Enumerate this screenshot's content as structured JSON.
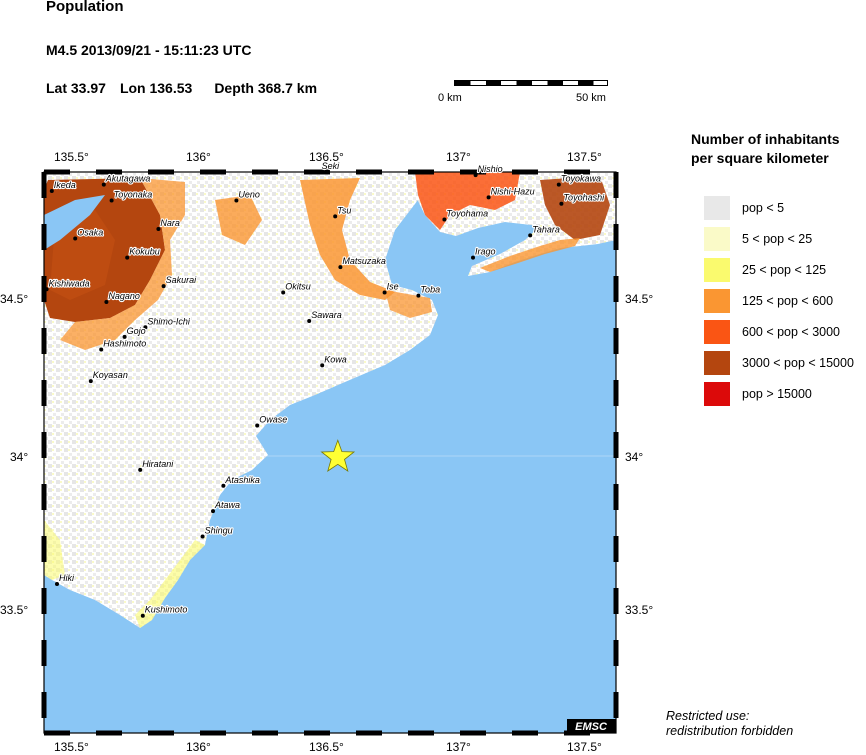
{
  "header": {
    "title": "Population",
    "event": "M4.5  2013/09/21 - 15:11:23 UTC",
    "lat": "Lat 33.97",
    "lon": "Lon 136.53",
    "depth": "Depth 368.7 km"
  },
  "scale_bar": {
    "start_label": "0 km",
    "end_label": "50 km"
  },
  "axes": {
    "lon_ticks": [
      "135.5°",
      "136°",
      "136.5°",
      "137°",
      "137.5°"
    ],
    "lat_ticks": [
      "34.5°",
      "34°",
      "33.5°"
    ]
  },
  "map": {
    "lon_range": [
      135.4,
      137.6
    ],
    "lat_range": [
      33.1,
      34.87
    ],
    "epicenter": {
      "lat": 33.97,
      "lon": 136.53
    },
    "colors": {
      "sea": "#8ac6f5",
      "epicenter": "#ffff33"
    },
    "cities": [
      {
        "name": "Akutagawa",
        "lat": 34.83,
        "lon": 135.63
      },
      {
        "name": "Ikeda",
        "lat": 34.81,
        "lon": 135.43
      },
      {
        "name": "Toyonaka",
        "lat": 34.78,
        "lon": 135.66
      },
      {
        "name": "Osaka",
        "lat": 34.66,
        "lon": 135.52
      },
      {
        "name": "Nara",
        "lat": 34.69,
        "lon": 135.84
      },
      {
        "name": "Kokubu",
        "lat": 34.6,
        "lon": 135.72
      },
      {
        "name": "Kishiwada",
        "lat": 34.5,
        "lon": 135.41
      },
      {
        "name": "Nagano",
        "lat": 34.46,
        "lon": 135.64
      },
      {
        "name": "Sakurai",
        "lat": 34.51,
        "lon": 135.86
      },
      {
        "name": "Shimo-Ichi",
        "lat": 34.38,
        "lon": 135.79
      },
      {
        "name": "Gojo",
        "lat": 34.35,
        "lon": 135.71
      },
      {
        "name": "Hashimoto",
        "lat": 34.31,
        "lon": 135.62
      },
      {
        "name": "Koyasan",
        "lat": 34.21,
        "lon": 135.58
      },
      {
        "name": "Ueno",
        "lat": 34.78,
        "lon": 136.14
      },
      {
        "name": "Seki",
        "lat": 34.87,
        "lon": 136.46
      },
      {
        "name": "Tsu",
        "lat": 34.73,
        "lon": 136.52
      },
      {
        "name": "Matsuzaka",
        "lat": 34.57,
        "lon": 136.54
      },
      {
        "name": "Ise",
        "lat": 34.49,
        "lon": 136.71
      },
      {
        "name": "Toba",
        "lat": 34.48,
        "lon": 136.84
      },
      {
        "name": "Okitsu",
        "lat": 34.49,
        "lon": 136.32
      },
      {
        "name": "Sawara",
        "lat": 34.4,
        "lon": 136.42
      },
      {
        "name": "Kowa",
        "lat": 34.26,
        "lon": 136.47
      },
      {
        "name": "Owase",
        "lat": 34.07,
        "lon": 136.22
      },
      {
        "name": "Hiratani",
        "lat": 33.93,
        "lon": 135.77
      },
      {
        "name": "Atashika",
        "lat": 33.88,
        "lon": 136.09
      },
      {
        "name": "Atawa",
        "lat": 33.8,
        "lon": 136.05
      },
      {
        "name": "Shingu",
        "lat": 33.72,
        "lon": 136.01
      },
      {
        "name": "Hiki",
        "lat": 33.57,
        "lon": 135.45
      },
      {
        "name": "Kushimoto",
        "lat": 33.47,
        "lon": 135.78
      },
      {
        "name": "Nishio",
        "lat": 34.86,
        "lon": 137.06
      },
      {
        "name": "Nishi-Hazu",
        "lat": 34.79,
        "lon": 137.11
      },
      {
        "name": "Toyokawa",
        "lat": 34.83,
        "lon": 137.38
      },
      {
        "name": "Toyohashi",
        "lat": 34.77,
        "lon": 137.39
      },
      {
        "name": "Toyohama",
        "lat": 34.72,
        "lon": 136.94
      },
      {
        "name": "Tahara",
        "lat": 34.67,
        "lon": 137.27
      },
      {
        "name": "Irago",
        "lat": 34.6,
        "lon": 137.05
      }
    ]
  },
  "legend": {
    "title_line1": "Number of inhabitants",
    "title_line2": "per square kilometer",
    "items": [
      {
        "label": "pop < 5",
        "color": "#e8e8e8"
      },
      {
        "label": "5 < pop < 25",
        "color": "#fafac8"
      },
      {
        "label": "25 < pop < 125",
        "color": "#fafa6e"
      },
      {
        "label": "125 < pop < 600",
        "color": "#fa9632"
      },
      {
        "label": "600 < pop < 3000",
        "color": "#fa5514"
      },
      {
        "label": "3000 < pop < 15000",
        "color": "#b4460f"
      },
      {
        "label": "pop > 15000",
        "color": "#dc0a0a"
      }
    ]
  },
  "watermark": "EMSC",
  "footer": {
    "line1": "Restricted use:",
    "line2": "redistribution forbidden"
  }
}
